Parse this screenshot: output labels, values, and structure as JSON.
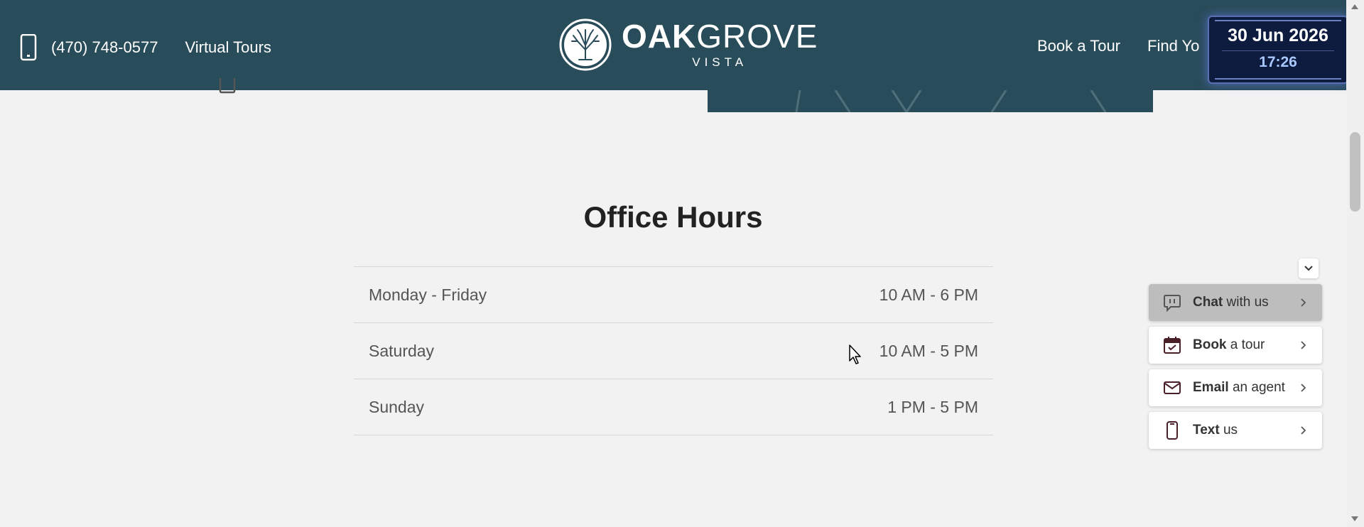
{
  "header": {
    "phone": "(470) 748-0577",
    "virtual_tours": "Virtual Tours",
    "logo_bold": "OAK",
    "logo_light": "GROVE",
    "logo_sub": "VISTA",
    "nav": [
      "Book a Tour",
      "Find Yo"
    ]
  },
  "clock": {
    "date": "30 Jun 2026",
    "time": "17:26"
  },
  "office_hours": {
    "title": "Office Hours",
    "rows": [
      {
        "day": "Monday - Friday",
        "hours": "10 AM - 6 PM"
      },
      {
        "day": "Saturday",
        "hours": "10 AM - 5 PM"
      },
      {
        "day": "Sunday",
        "hours": "1 PM - 5 PM"
      }
    ]
  },
  "widget": {
    "buttons": [
      {
        "bold": "Chat",
        "rest": " with us",
        "icon": "chat-icon"
      },
      {
        "bold": "Book",
        "rest": " a tour",
        "icon": "calendar-icon"
      },
      {
        "bold": "Email",
        "rest": " an agent",
        "icon": "envelope-icon"
      },
      {
        "bold": "Text",
        "rest": " us",
        "icon": "mobile-phone-icon"
      }
    ]
  },
  "colors": {
    "header_bg": "#294c5a",
    "page_bg": "#f3f2f2",
    "clock_bg": "#0d1b3f"
  }
}
